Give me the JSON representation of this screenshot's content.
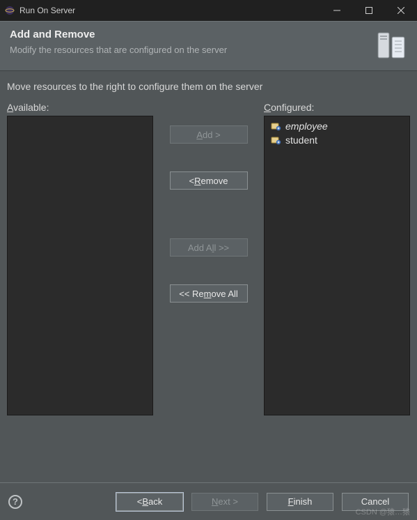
{
  "window": {
    "title": "Run On Server"
  },
  "header": {
    "title": "Add and Remove",
    "subtitle": "Modify the resources that are configured on the server"
  },
  "instruction": "Move resources to the right to configure them on the server",
  "labels": {
    "available_pre": "A",
    "available_rest": "vailable:",
    "configured_pre": "C",
    "configured_rest": "onfigured:"
  },
  "buttons": {
    "add_pre": "A",
    "add_rest": "dd >",
    "remove_pre": "< ",
    "remove_mn": "R",
    "remove_rest": "emove",
    "addall_pre": "Add A",
    "addall_mn": "l",
    "addall_rest": "l >>",
    "removeall_pre": "<< Re",
    "removeall_mn": "m",
    "removeall_rest": "ove All"
  },
  "available_items": [],
  "configured_items": [
    {
      "label": "employee",
      "italic": true
    },
    {
      "label": "student",
      "italic": false
    }
  ],
  "wizard": {
    "back_pre": "< ",
    "back_mn": "B",
    "back_rest": "ack",
    "next_mn": "N",
    "next_rest": "ext >",
    "finish_mn": "F",
    "finish_rest": "inish",
    "cancel": "Cancel"
  },
  "watermark": "CSDN @猿…猿"
}
